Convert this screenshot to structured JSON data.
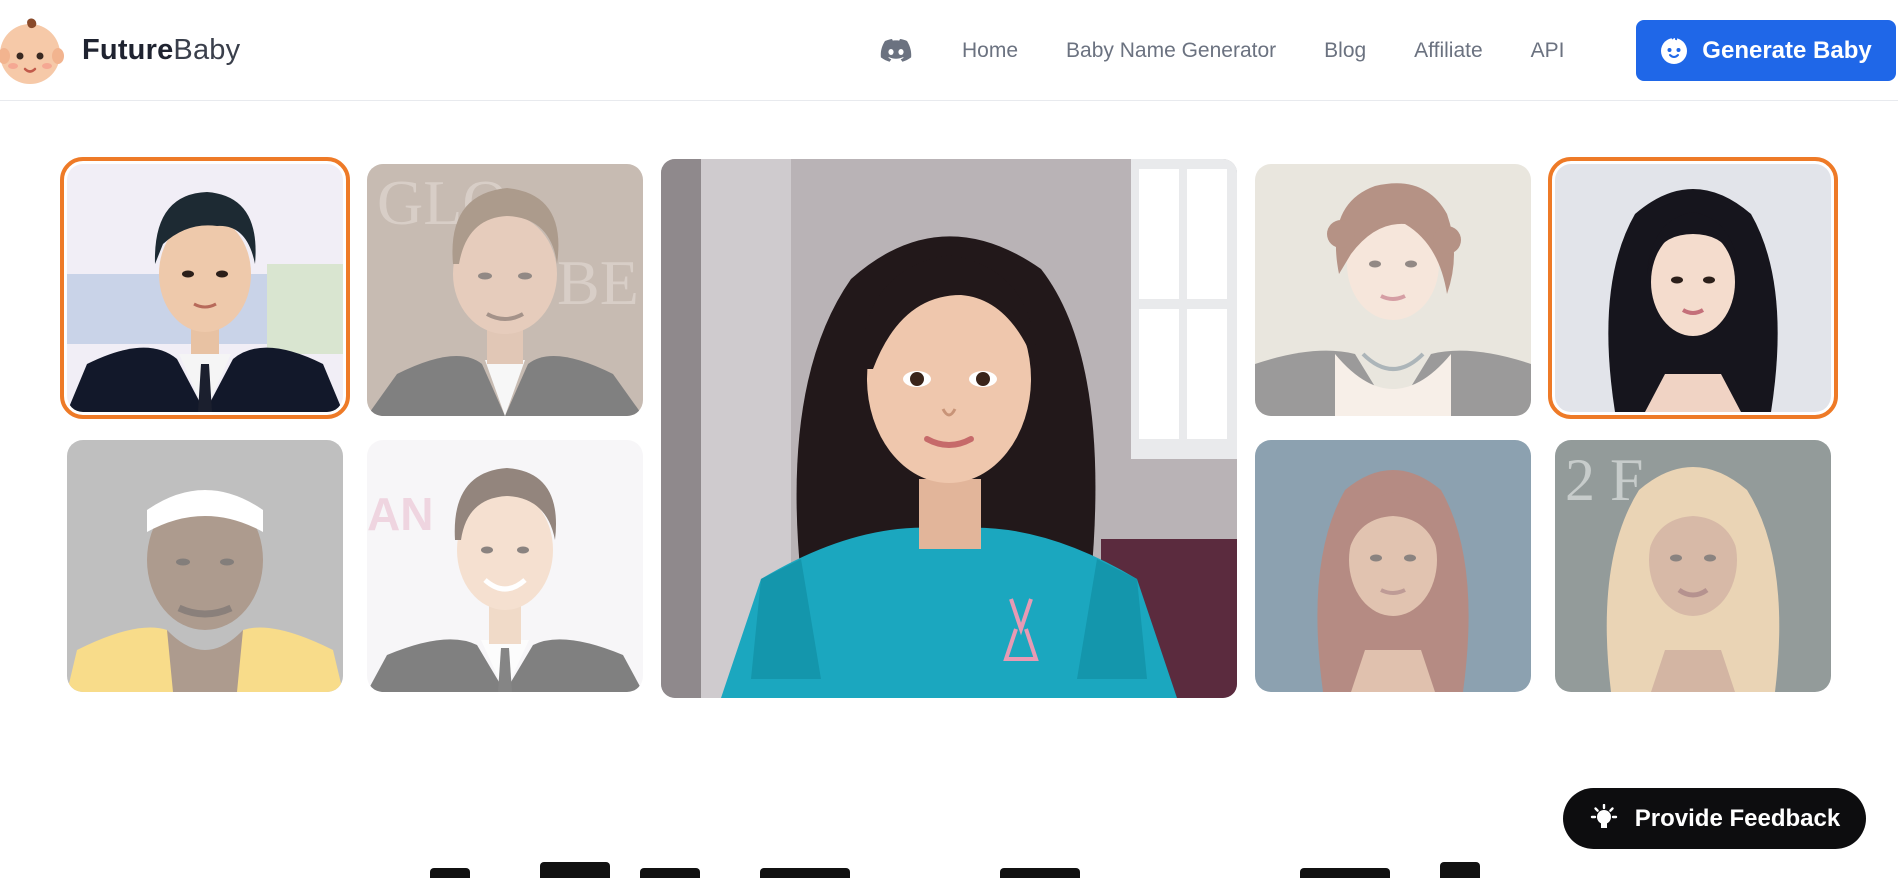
{
  "brand": {
    "name_bold": "Future",
    "name_light": "Baby",
    "logo_icon": "baby-face-logo-icon"
  },
  "nav": {
    "discord_icon": "discord-icon",
    "links": [
      "Home",
      "Baby Name Generator",
      "Blog",
      "Affiliate",
      "API"
    ]
  },
  "cta": {
    "label": "Generate Baby",
    "icon": "baby-face-icon",
    "color": "#1f67e8"
  },
  "gallery": {
    "selected_border_color": "#ee7a27",
    "parents": [
      {
        "position": "top-left",
        "selected": true,
        "desc": "man-in-suit-dark-hair"
      },
      {
        "position": "top-second",
        "selected": false,
        "desc": "man-slicked-hair-suit"
      },
      {
        "position": "bottom-left",
        "selected": false,
        "desc": "man-headband-yellow-jersey"
      },
      {
        "position": "bottom-second",
        "selected": false,
        "desc": "young-man-suit-smiling"
      },
      {
        "position": "top-fourth",
        "selected": false,
        "desc": "woman-curly-hair-necklace"
      },
      {
        "position": "top-right",
        "selected": true,
        "desc": "woman-long-dark-hair"
      },
      {
        "position": "bottom-fourth",
        "selected": false,
        "desc": "woman-red-hair"
      },
      {
        "position": "bottom-right",
        "selected": false,
        "desc": "woman-blonde-wavy-hair"
      }
    ],
    "result": {
      "desc": "girl-long-dark-hair-teal-shirt"
    }
  },
  "feedback": {
    "label": "Provide Feedback",
    "icon": "lightbulb-icon"
  }
}
